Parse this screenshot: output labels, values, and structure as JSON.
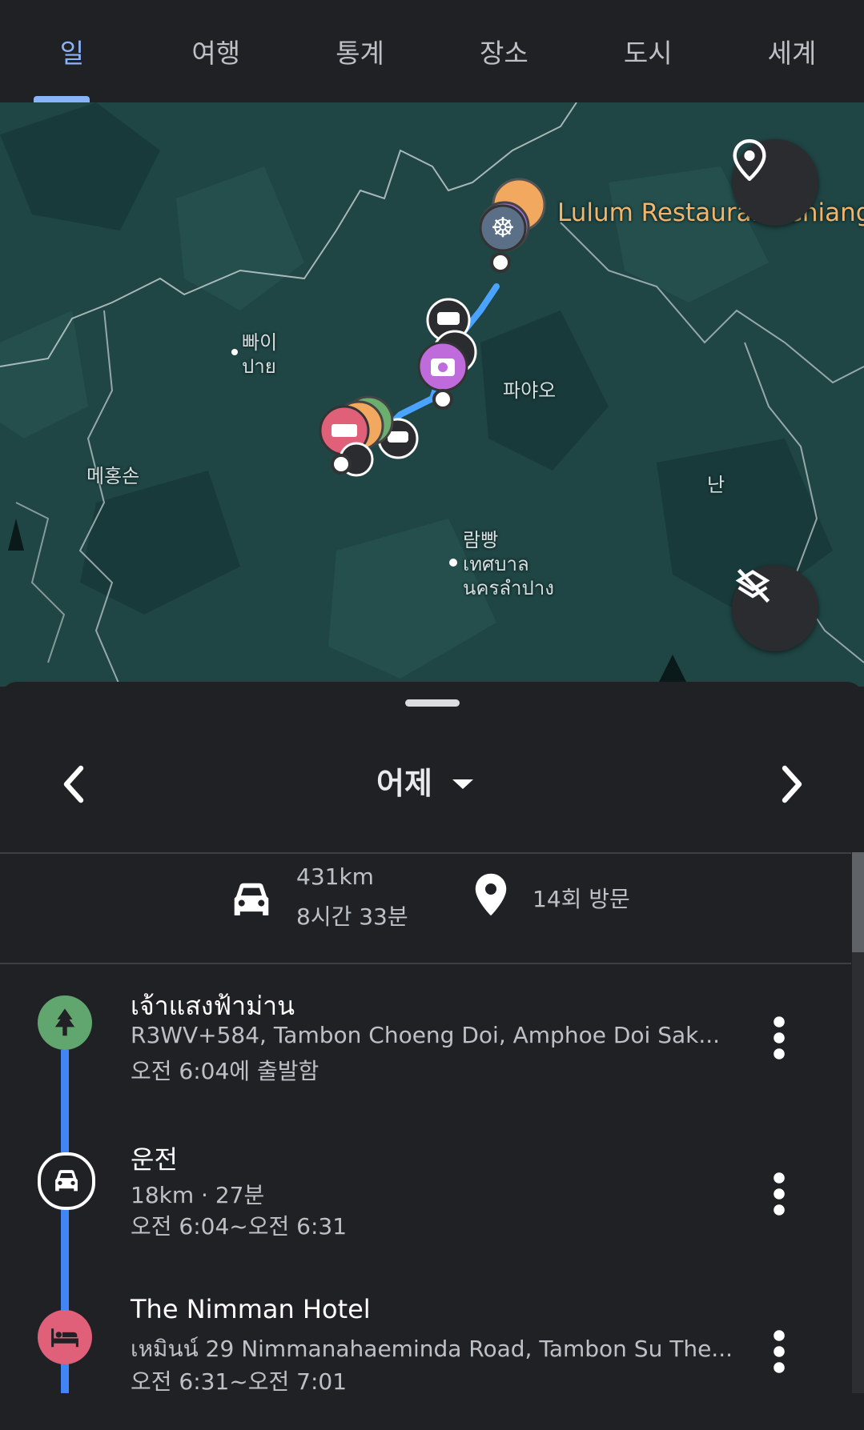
{
  "tabs": [
    {
      "label": "일",
      "active": true
    },
    {
      "label": "여행",
      "active": false
    },
    {
      "label": "통계",
      "active": false
    },
    {
      "label": "장소",
      "active": false
    },
    {
      "label": "도시",
      "active": false
    },
    {
      "label": "세계",
      "active": false
    }
  ],
  "map": {
    "labels": {
      "pai_ko": "빠이",
      "pai_th": "ปาย",
      "phayao": "파야오",
      "maehongson": "메홍손",
      "nan": "난",
      "lampang_ko": "람빵",
      "lampang_th1": "เทศบาล",
      "lampang_th2": "นครลำปาง"
    },
    "poi_label": "Lulum Restaurant Chiang",
    "location_button_icon": "location-pin-icon",
    "layers_off_button_icon": "layers-off-icon",
    "colors": {
      "land": "#1f4544",
      "route": "#4aa3ff",
      "borders": "#c9d3d4"
    }
  },
  "date_selector": {
    "label": "어제",
    "prev_icon": "chevron-left-icon",
    "next_icon": "chevron-right-icon"
  },
  "summary": {
    "distance": "431km",
    "duration": "8시간 33분",
    "visits": "14회 방문"
  },
  "timeline": [
    {
      "type": "place",
      "icon": "tree-icon",
      "icon_color": "#62a66f",
      "title": "เจ้าแสงฟ้าม่าน",
      "address": "R3WV+584, Tambon Choeng Doi, Amphoe Doi Sak...",
      "time": "오전 6:04에 출발함"
    },
    {
      "type": "activity",
      "icon": "car-icon",
      "title": "운전",
      "detail": "18km · 27분",
      "time": "오전 6:04~오전 6:31"
    },
    {
      "type": "place",
      "icon": "hotel-bed-icon",
      "icon_color": "#e0607a",
      "title": "The Nimman Hotel",
      "address": "เหมินน์ 29 Nimmanahaeminda Road, Tambon Su The...",
      "time": "오전 6:31~오전 7:01"
    }
  ],
  "accent": "#8ab4f8"
}
